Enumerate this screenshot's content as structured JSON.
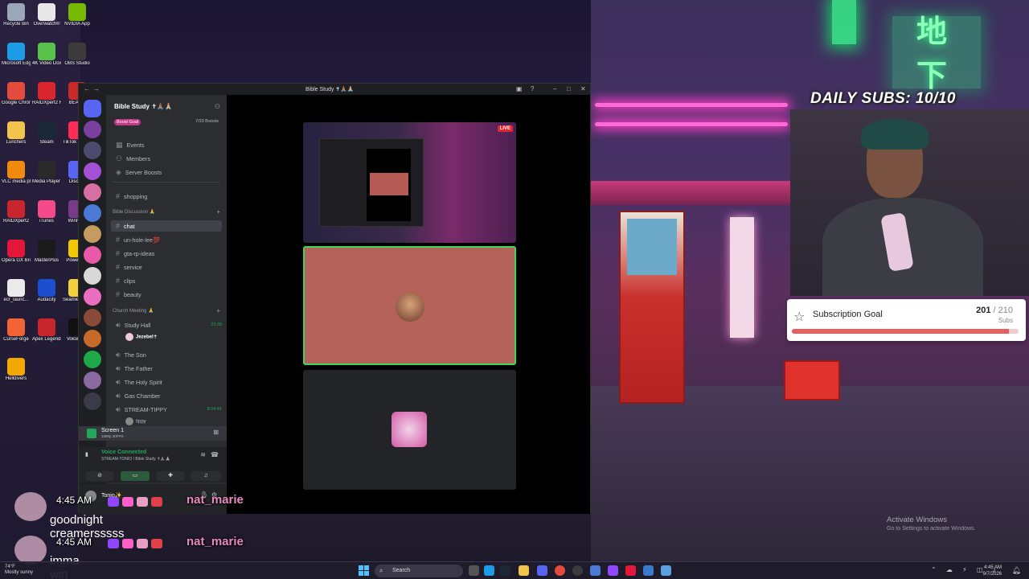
{
  "discord": {
    "window_title": "Bible Study ✝🙏🏽🙏🏼",
    "guild_name": "Bible Study ✝🙏🏽🙏🏼",
    "boost_goal_label": "Boost Goal",
    "boost_count": "7/33 Boosts",
    "nav_items": [
      {
        "label": "Events",
        "icon": "calendar-icon"
      },
      {
        "label": "Members",
        "icon": "members-icon"
      },
      {
        "label": "Server Boosts",
        "icon": "boost-icon"
      }
    ],
    "channels_top": [
      {
        "label": "shopping"
      }
    ],
    "category_bible": "Bible Discussion 🙏",
    "bible_channels": [
      {
        "label": "chat"
      },
      {
        "label": "un-hole-lee💯"
      },
      {
        "label": "gta-rp-ideas"
      },
      {
        "label": "service"
      },
      {
        "label": "clips"
      },
      {
        "label": "beauty"
      }
    ],
    "category_church": "Church Meeting 🙏",
    "voice_channels": [
      {
        "label": "Study Hall",
        "time": "23:35"
      },
      {
        "label": "The Son"
      },
      {
        "label": "The Father"
      },
      {
        "label": "The Holy Spirit"
      },
      {
        "label": "Gas Chamber"
      },
      {
        "label": "STREAM-TIPPY",
        "time": "8:24:41"
      }
    ],
    "study_hall_user": "Jezebel✝",
    "stream_user": "tippy",
    "screen_bar": {
      "title": "Screen 1",
      "subtitle": "1080p 30FPS"
    },
    "voice": {
      "status": "Voice Connected",
      "channel": "STREAM-TONIO / Bible Study ✝🙏🏽🙏🏼"
    },
    "user_bar": "Tonio✨",
    "live_label": "LIVE"
  },
  "chat": [
    {
      "time": "4:45 AM",
      "name": "nat_marie",
      "message": "goodnight creamersssss"
    },
    {
      "time": "4:45 AM",
      "name": "nat_marie",
      "message": "imma win"
    }
  ],
  "overlay": {
    "daily_subs": "DAILY SUBS: 10/10",
    "goal_title": "Subscription Goal",
    "goal_current": "201",
    "goal_total": "210",
    "goal_separator": " / ",
    "goal_unit": "Subs",
    "goal_fraction": 0.957
  },
  "desktop_icons": [
    {
      "label": "Recycle Bin",
      "color": "#9aa7b8"
    },
    {
      "label": "Overwatch®",
      "color": "#e8e8e8"
    },
    {
      "label": "NVIDIA App",
      "color": "#76b900"
    },
    {
      "label": "Microsoft Edge",
      "color": "#1c9be8"
    },
    {
      "label": "4K Video Download...",
      "color": "#58c14a"
    },
    {
      "label": "OBS Studio",
      "color": "#3b3b3b"
    },
    {
      "label": "Google Chrome",
      "color": "#e34b3c"
    },
    {
      "label": "RAIDXpert2 Help",
      "color": "#d8262c"
    },
    {
      "label": "BEACN",
      "color": "#c82a2a"
    },
    {
      "label": "Lunchers",
      "color": "#f2c44c"
    },
    {
      "label": "Steam",
      "color": "#1b2838"
    },
    {
      "label": "TikTok LIVE Studio",
      "color": "#ff2c55"
    },
    {
      "label": "VLC media player",
      "color": "#f28a10"
    },
    {
      "label": "Media Player Classic",
      "color": "#2a2a2a"
    },
    {
      "label": "Discord",
      "color": "#5865f2"
    },
    {
      "label": "RAIDXpert2",
      "color": "#c8262c"
    },
    {
      "label": "iTunes",
      "color": "#f54a8a"
    },
    {
      "label": "WinRAR",
      "color": "#7a3a8a"
    },
    {
      "label": "Opera GX Browser",
      "color": "#e2173a"
    },
    {
      "label": "MasterPlus",
      "color": "#1a1a1a"
    },
    {
      "label": "PowerISO",
      "color": "#f2c800"
    },
    {
      "label": "ecr_launc...",
      "color": "#eaeaea"
    },
    {
      "label": "Audacity",
      "color": "#1c4fd0"
    },
    {
      "label": "Seamless Co-op v1.9...",
      "color": "#f2d23c"
    },
    {
      "label": "CurseForge",
      "color": "#f16436"
    },
    {
      "label": "Apex Legends",
      "color": "#c8262c"
    },
    {
      "label": "Voicemod",
      "color": "#111"
    },
    {
      "label": "Helldivers",
      "color": "#f2a800"
    }
  ],
  "windows": {
    "activate_title": "Activate Windows",
    "activate_sub": "Go to Settings to activate Windows."
  },
  "taskbar": {
    "weather_temp": "74°F",
    "weather_desc": "Mostly sunny",
    "search_placeholder": "Search",
    "time": "4:45 AM",
    "date": "9/7/2026"
  }
}
